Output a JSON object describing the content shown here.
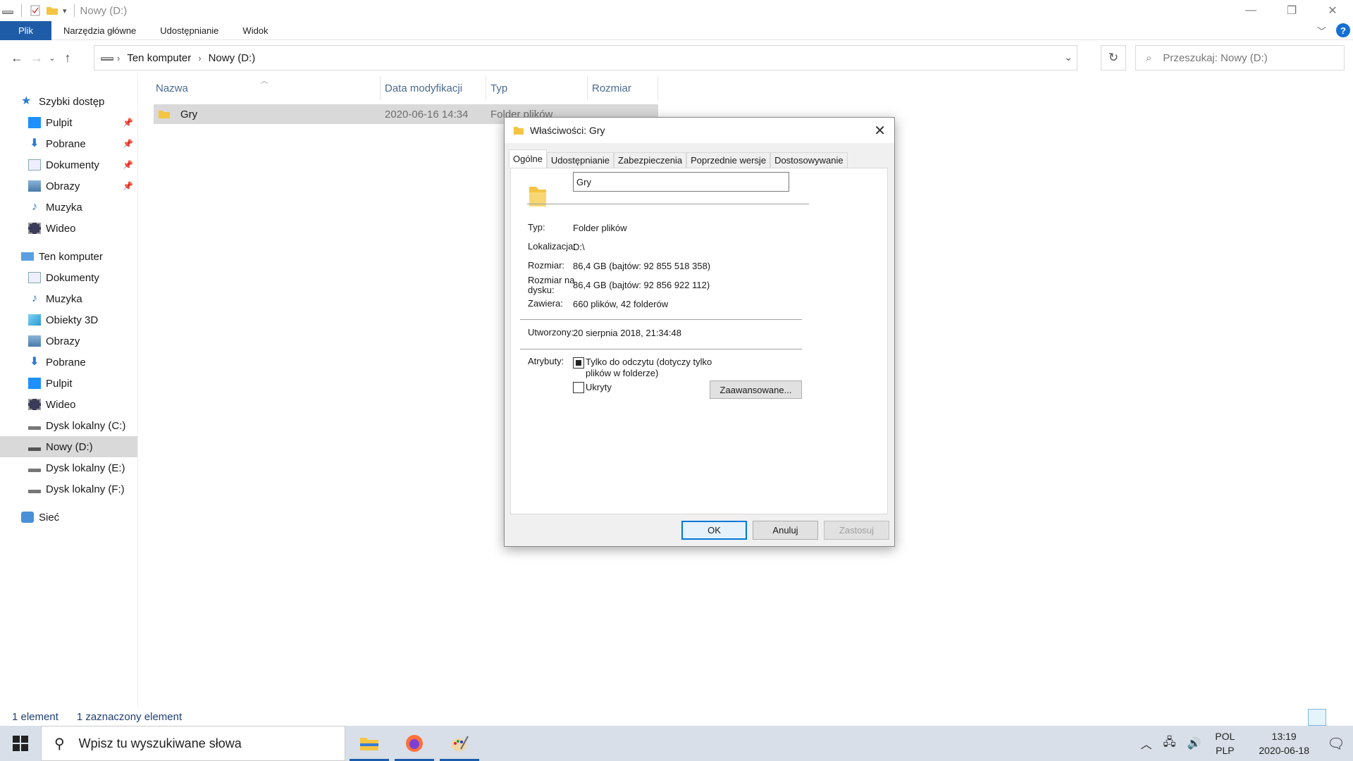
{
  "window": {
    "title": "Nowy (D:)",
    "controls": {
      "minimize": "—",
      "maximize": "❐",
      "close": "✕"
    }
  },
  "ribbon": {
    "tabs": [
      "Plik",
      "Narzędzia główne",
      "Udostępnianie",
      "Widok"
    ]
  },
  "address": {
    "crumbs": [
      "Ten komputer",
      "Nowy (D:)"
    ],
    "search_placeholder": "Przeszukaj: Nowy (D:)"
  },
  "sidebar": {
    "quick_access": "Szybki dostęp",
    "quick_items": [
      "Pulpit",
      "Pobrane",
      "Dokumenty",
      "Obrazy",
      "Muzyka",
      "Wideo"
    ],
    "this_pc": "Ten komputer",
    "pc_items": [
      "Dokumenty",
      "Muzyka",
      "Obiekty 3D",
      "Obrazy",
      "Pobrane",
      "Pulpit",
      "Wideo",
      "Dysk lokalny (C:)",
      "Nowy (D:)",
      "Dysk lokalny (E:)",
      "Dysk lokalny (F:)"
    ],
    "network": "Sieć"
  },
  "filelist": {
    "columns": [
      "Nazwa",
      "Data modyfikacji",
      "Typ",
      "Rozmiar"
    ],
    "rows": [
      {
        "name": "Gry",
        "date": "2020-06-16 14:34",
        "type": "Folder plików"
      }
    ]
  },
  "status": {
    "count": "1 element",
    "selected": "1 zaznaczony element"
  },
  "dialog": {
    "title": "Właściwości: Gry",
    "tabs": [
      "Ogólne",
      "Udostępnianie",
      "Zabezpieczenia",
      "Poprzednie wersje",
      "Dostosowywanie"
    ],
    "name_value": "Gry",
    "props": {
      "type_label": "Typ:",
      "type_value": "Folder plików",
      "location_label": "Lokalizacja:",
      "location_value": "D:\\",
      "size_label": "Rozmiar:",
      "size_value": "86,4 GB (bajtów: 92 855 518 358)",
      "disk_size_label": "Rozmiar na dysku:",
      "disk_size_value": "86,4 GB (bajtów: 92 856 922 112)",
      "contains_label": "Zawiera:",
      "contains_value": "660 plików, 42 folderów",
      "created_label": "Utworzony:",
      "created_value": "20 sierpnia 2018, 21:34:48",
      "attributes_label": "Atrybuty:",
      "readonly_label": "Tylko do odczytu (dotyczy tylko plików w folderze)",
      "hidden_label": "Ukryty",
      "advanced_button": "Zaawansowane..."
    },
    "buttons": {
      "ok": "OK",
      "cancel": "Anuluj",
      "apply": "Zastosuj"
    }
  },
  "taskbar": {
    "search_placeholder": "Wpisz tu wyszukiwane słowa",
    "lang_top": "POL",
    "lang_bottom": "PLP",
    "time": "13:19",
    "date": "2020-06-18"
  },
  "colors": {
    "accent": "#1f5ca8",
    "folder": "#f4c542",
    "taskbar": "#d8dfe8",
    "selection": "#d9d9d9"
  }
}
